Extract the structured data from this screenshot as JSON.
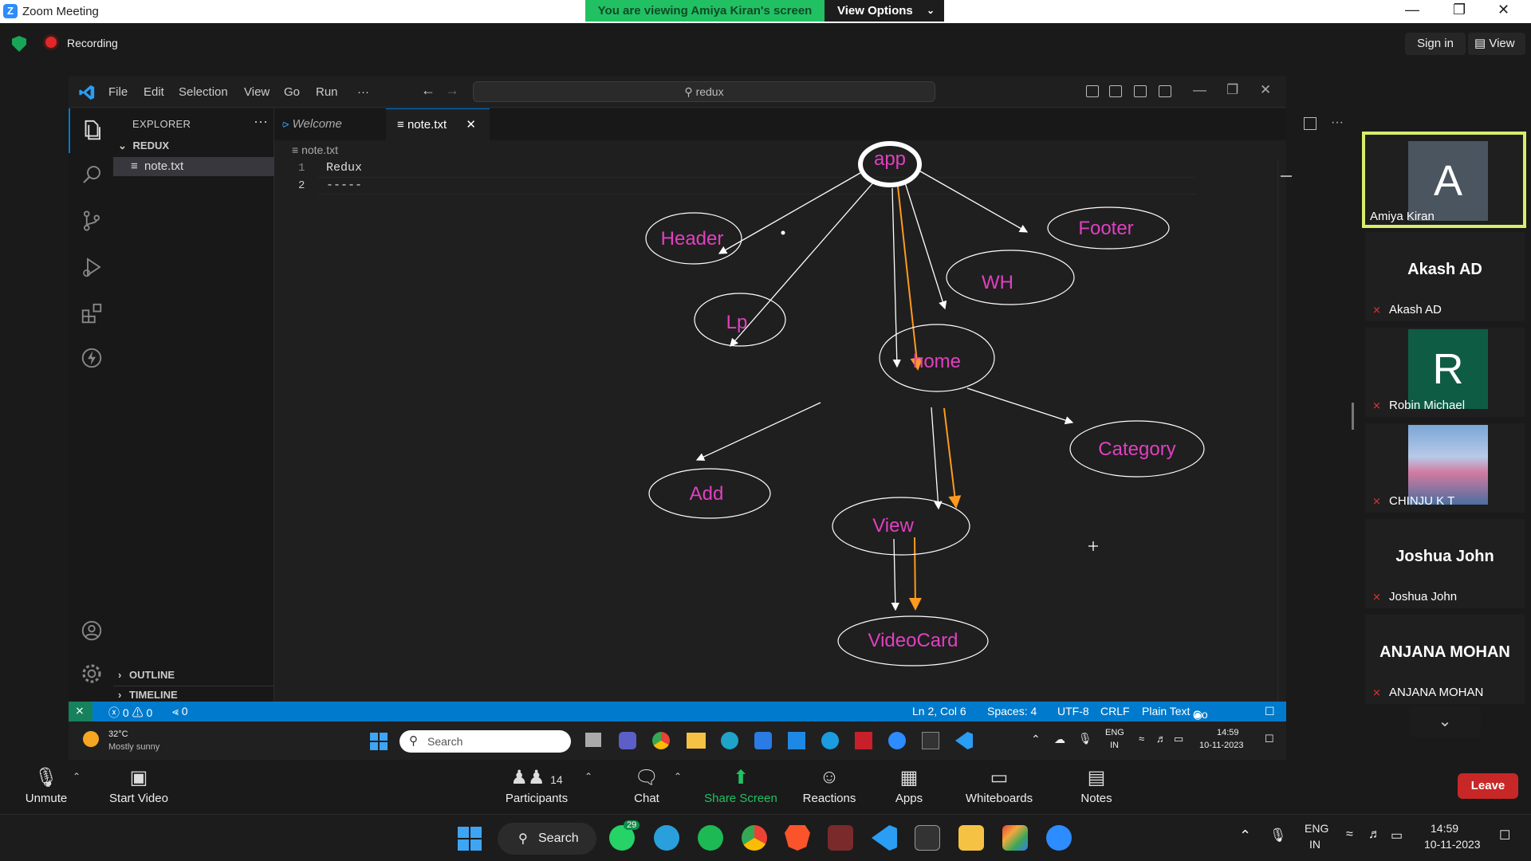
{
  "zoom": {
    "window_title": "Zoom Meeting",
    "banner": "You are viewing Amiya Kiran's screen",
    "view_options": "View Options",
    "recording": "Recording",
    "sign_in": "Sign in",
    "view": "View"
  },
  "vscode": {
    "menu": [
      "File",
      "Edit",
      "Selection",
      "View",
      "Go",
      "Run",
      "···"
    ],
    "search": "redux",
    "explorer_title": "EXPLORER",
    "folder": "REDUX",
    "file": "note.txt",
    "outline": "OUTLINE",
    "timeline": "TIMELINE",
    "tabs": {
      "welcome": "Welcome",
      "note": "note.txt"
    },
    "breadcrumb": "note.txt",
    "lines": [
      {
        "num": "1",
        "text": "Redux"
      },
      {
        "num": "2",
        "text": "-----"
      }
    ],
    "diagram_nodes": {
      "app": "app",
      "header": "Header",
      "footer": "Footer",
      "wh": "WH",
      "lp": "Lp",
      "home": "home",
      "category": "Category",
      "add": "Add",
      "view": "View",
      "videocard": "VideoCard"
    },
    "status": {
      "errors": "ⓧ 0 ⚠ 0",
      "ports": "⪡ 0",
      "position": "Ln 2, Col 6",
      "spaces": "Spaces: 4",
      "encoding": "UTF-8",
      "eol": "CRLF",
      "language": "Plain Text",
      "golive": "Go Live"
    }
  },
  "inner_taskbar": {
    "temp": "32°C",
    "weather": "Mostly sunny",
    "search": "Search",
    "lang1": "ENG",
    "lang2": "IN",
    "time": "14:59",
    "date": "10-11-2023"
  },
  "participants": [
    {
      "name": "Amiya Kiran",
      "initial": "A",
      "color": "#4a5560"
    },
    {
      "name": "Akash AD",
      "display": "Akash AD"
    },
    {
      "name": "Robin Michael",
      "initial": "R",
      "color": "#0f5c45"
    },
    {
      "name": "CHINJU K T"
    },
    {
      "name": "Joshua John",
      "display": "Joshua John"
    },
    {
      "name": "ANJANA MOHAN",
      "display": "ANJANA MOHAN"
    }
  ],
  "controls": {
    "unmute": "Unmute",
    "start_video": "Start Video",
    "participants": "Participants",
    "participants_count": "14",
    "chat": "Chat",
    "share_screen": "Share Screen",
    "reactions": "Reactions",
    "apps": "Apps",
    "whiteboards": "Whiteboards",
    "notes": "Notes",
    "leave": "Leave"
  },
  "host_taskbar": {
    "search": "Search",
    "whatsapp_badge": "29",
    "lang1": "ENG",
    "lang2": "IN",
    "time": "14:59",
    "date": "10-11-2023"
  },
  "colors": {
    "accent": "#007acc",
    "node_text": "#e040c0",
    "arrow_orange": "#ff9a1f",
    "banner_green": "#21c163",
    "leave_red": "#c82727"
  }
}
